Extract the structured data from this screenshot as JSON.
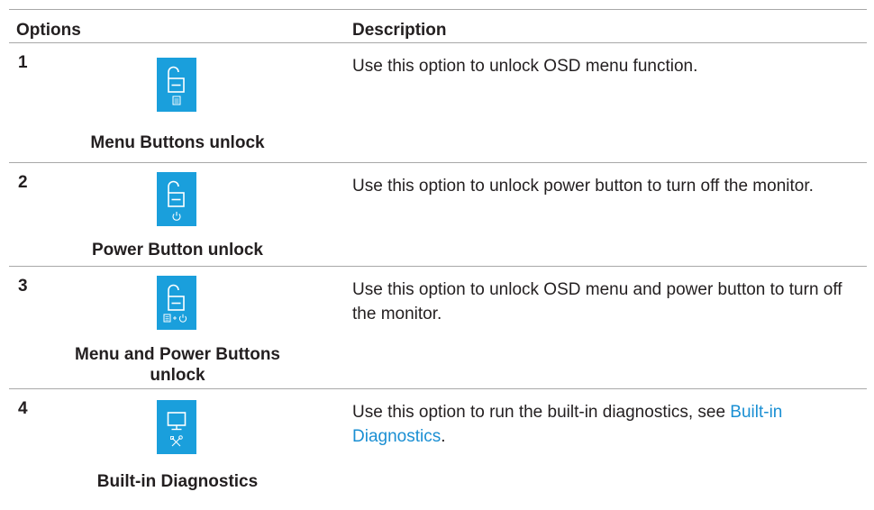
{
  "header": {
    "options": "Options",
    "description": "Description"
  },
  "rows": [
    {
      "number": "1",
      "icon": "lock-open-menu-icon",
      "caption": "Menu Buttons unlock",
      "description": "Use this option to unlock OSD menu function."
    },
    {
      "number": "2",
      "icon": "lock-open-power-icon",
      "caption": "Power Button unlock",
      "description": "Use this option to unlock power button to turn off the monitor."
    },
    {
      "number": "3",
      "icon": "lock-open-menu-power-icon",
      "caption": "Menu and Power Buttons unlock",
      "description": "Use this option to unlock OSD menu and power button to turn off the monitor."
    },
    {
      "number": "4",
      "icon": "monitor-diagnostics-icon",
      "caption": "Built-in Diagnostics",
      "description_prefix": "Use this option to run the built-in diagnostics, see ",
      "description_link": "Built-in Diagnostics",
      "description_suffix": "."
    }
  ],
  "colors": {
    "icon_bg": "#1a9fdc",
    "link": "#1a8fd3",
    "rule": "#a8a8a8"
  }
}
